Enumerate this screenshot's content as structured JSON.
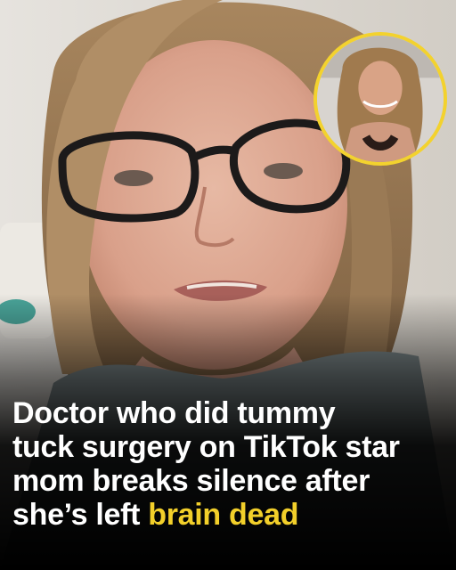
{
  "headline": {
    "line1": "Doctor who did tummy",
    "line2": "tuck surgery on TikTok star",
    "line3": "mom breaks silence after",
    "line4_prefix": "she’s left ",
    "line4_highlight": "brain dead"
  },
  "colors": {
    "highlight": "#f2cf2a",
    "inset_border": "#f3d22e",
    "text": "#ffffff"
  }
}
